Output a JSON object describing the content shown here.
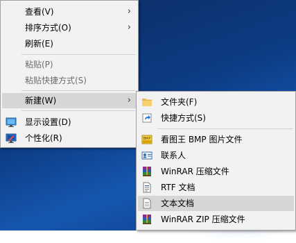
{
  "main_menu": {
    "items": [
      {
        "label": "查看(V)"
      },
      {
        "label": "排序方式(O)"
      },
      {
        "label": "刷新(E)"
      },
      {
        "label": "粘贴(P)"
      },
      {
        "label": "粘贴快捷方式(S)"
      },
      {
        "label": "新建(W)"
      },
      {
        "label": "显示设置(D)"
      },
      {
        "label": "个性化(R)"
      }
    ]
  },
  "sub_menu": {
    "items": [
      {
        "label": "文件夹(F)",
        "icon": "folder-icon"
      },
      {
        "label": "快捷方式(S)",
        "icon": "shortcut-icon"
      },
      {
        "label": "看图王 BMP 图片文件",
        "icon": "bmp-image-icon"
      },
      {
        "label": "联系人",
        "icon": "contact-card-icon"
      },
      {
        "label": "WinRAR 压缩文件",
        "icon": "winrar-archive-icon"
      },
      {
        "label": "RTF 文档",
        "icon": "rtf-document-icon"
      },
      {
        "label": "文本文档",
        "icon": "text-document-icon"
      },
      {
        "label": "WinRAR ZIP 压缩文件",
        "icon": "winrar-zip-icon"
      }
    ]
  },
  "colors": {
    "desktop": "#0d3c84",
    "menu_bg": "#f2f2f2",
    "highlight": "#d6d6d6",
    "disabled_text": "#6d6d6d"
  }
}
